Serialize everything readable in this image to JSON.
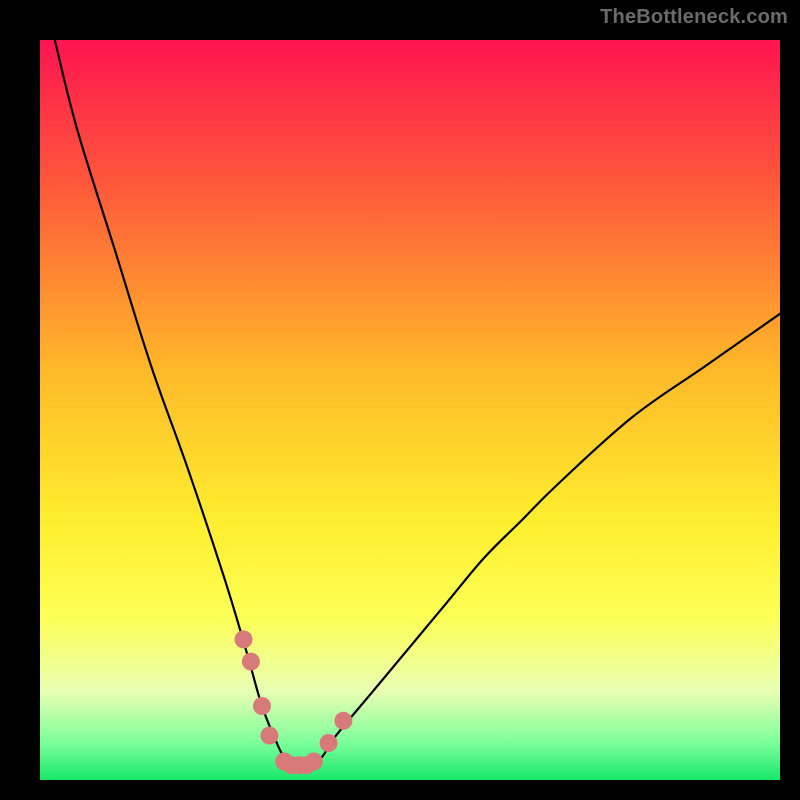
{
  "watermark": {
    "text": "TheBottleneck.com"
  },
  "chart_data": {
    "type": "line",
    "title": "",
    "xlabel": "",
    "ylabel": "",
    "xlim": [
      0,
      100
    ],
    "ylim": [
      0,
      100
    ],
    "grid": false,
    "series": [
      {
        "name": "bottleneck-curve",
        "color": "#000000",
        "x": [
          2,
          5,
          10,
          15,
          20,
          25,
          28,
          30,
          32,
          33,
          34,
          35,
          36,
          38,
          40,
          45,
          50,
          55,
          60,
          65,
          70,
          80,
          90,
          100
        ],
        "values": [
          100,
          88,
          72,
          56,
          42,
          27,
          17,
          10,
          5,
          3,
          2,
          2,
          2,
          3,
          6,
          12,
          18,
          24,
          30,
          35,
          40,
          49,
          56,
          63
        ]
      }
    ],
    "markers": {
      "name": "curve-markers",
      "color": "#d87a7a",
      "x": [
        27.5,
        28.5,
        30,
        31,
        33,
        34,
        35,
        36,
        37,
        39,
        41
      ],
      "values": [
        19,
        16,
        10,
        6,
        2.5,
        2,
        2,
        2,
        2.5,
        5,
        8
      ]
    },
    "gradient_stops": [
      {
        "pct": 0,
        "color": "#ff1450"
      },
      {
        "pct": 20,
        "color": "#ff5a3a"
      },
      {
        "pct": 45,
        "color": "#ffba29"
      },
      {
        "pct": 65,
        "color": "#ffee2e"
      },
      {
        "pct": 78,
        "color": "#fcff55"
      },
      {
        "pct": 88,
        "color": "#e9ffb3"
      },
      {
        "pct": 95,
        "color": "#7cff9a"
      },
      {
        "pct": 100,
        "color": "#17e86a"
      }
    ]
  }
}
